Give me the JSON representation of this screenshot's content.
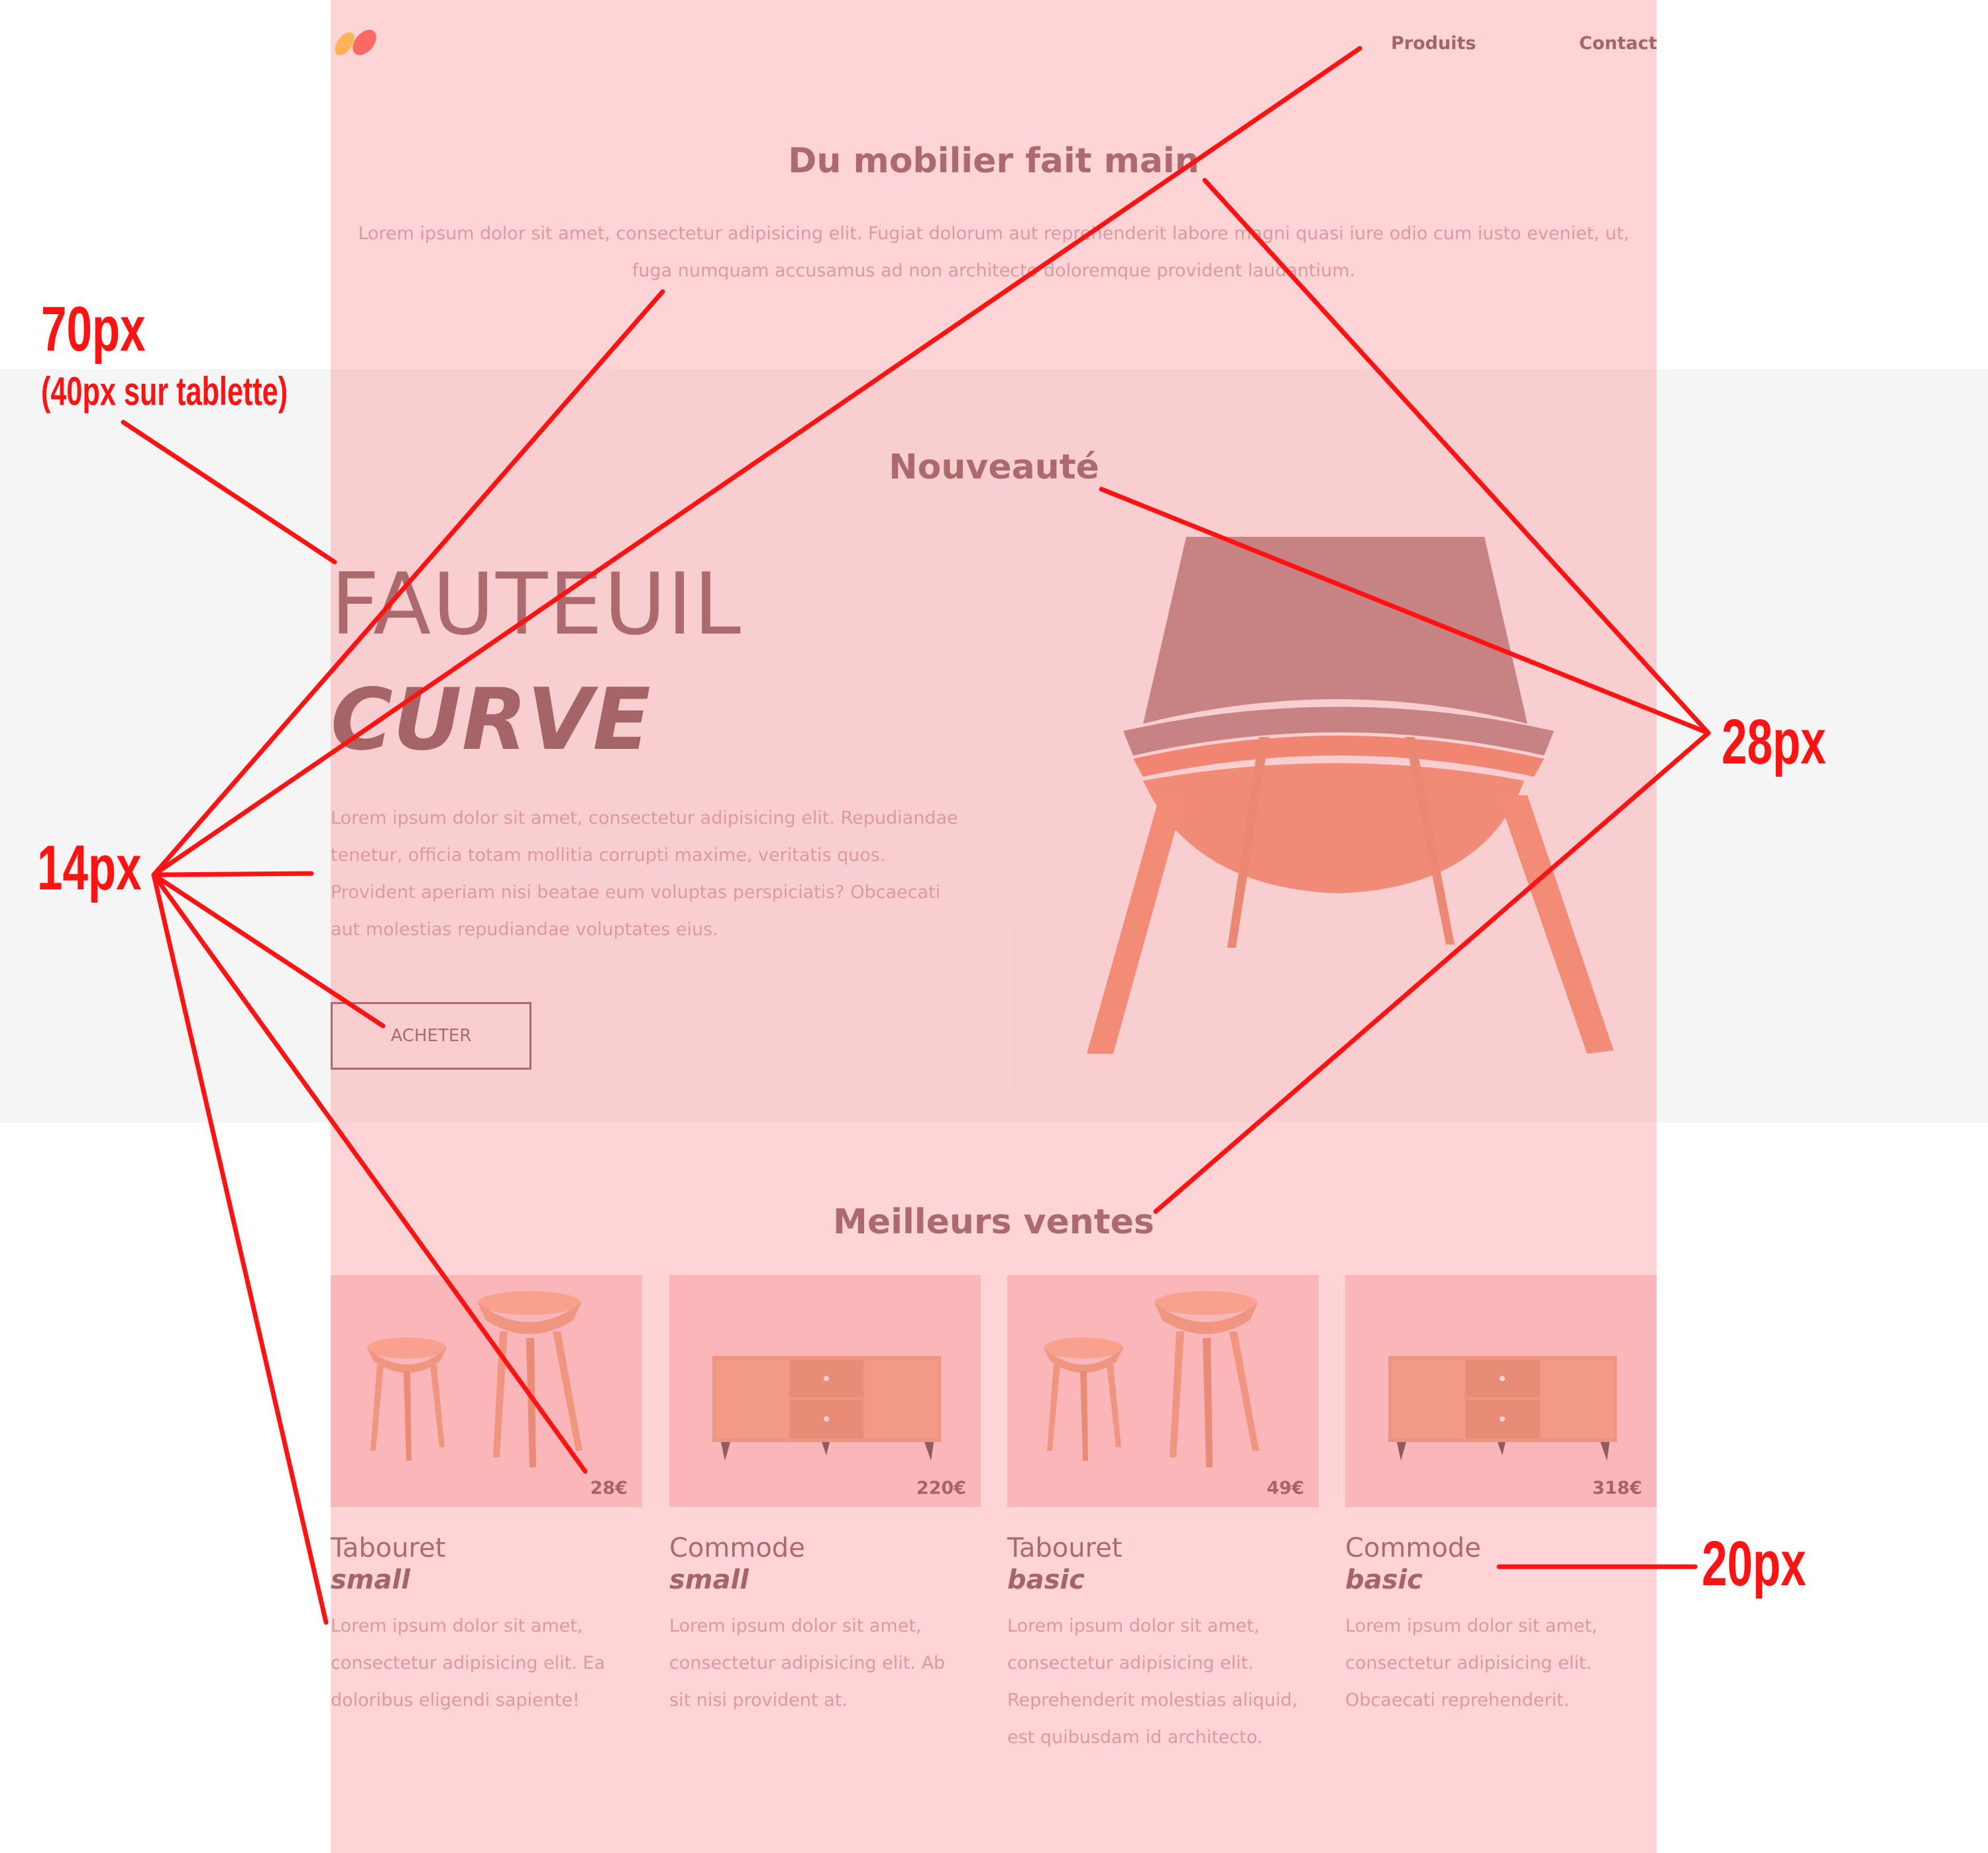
{
  "nav": {
    "products": "Produits",
    "contact": "Contact"
  },
  "intro": {
    "title": "Du mobilier fait main",
    "text_line1": "Lorem ipsum dolor sit amet, consectetur adipisicing elit. Fugiat dolorum aut reprehenderit labore magni quasi iure odio cum iusto eveniet, ut,",
    "text_line2": "fuga numquam accusamus ad non architecto doloremque provident laudantium."
  },
  "hero": {
    "label": "Nouveauté",
    "title": "FAUTEUIL",
    "subtitle": "CURVE",
    "text_lines": [
      "Lorem ipsum dolor sit amet, consectetur adipisicing elit. Repudiandae",
      "tenetur, officia totam mollitia corrupti maxime, veritatis quos.",
      "Provident aperiam nisi beatae eum voluptas perspiciatis? Obcaecati",
      "aut molestias repudiandae voluptates eius."
    ],
    "button": "ACHETER"
  },
  "best": {
    "title": "Meilleurs ventes",
    "products": [
      {
        "price": "28€",
        "name": "Tabouret",
        "variant": "small",
        "image": "stools-image",
        "desc_lines": [
          "Lorem ipsum dolor sit amet,",
          "consectetur adipisicing elit. Ea",
          "doloribus eligendi sapiente!"
        ]
      },
      {
        "price": "220€",
        "name": "Commode",
        "variant": "small",
        "image": "sideboard-image",
        "desc_lines": [
          "Lorem ipsum dolor sit amet,",
          "consectetur adipisicing elit. Ab",
          "sit nisi provident at."
        ]
      },
      {
        "price": "49€",
        "name": "Tabouret",
        "variant": "basic",
        "image": "stools-image",
        "desc_lines": [
          "Lorem ipsum dolor sit amet,",
          "consectetur adipisicing elit.",
          "Reprehenderit molestias aliquid,",
          "est quibusdam id architecto."
        ]
      },
      {
        "price": "318€",
        "name": "Commode",
        "variant": "basic",
        "image": "sideboard-image",
        "desc_lines": [
          "Lorem ipsum dolor sit amet,",
          "consectetur adipisicing elit.",
          "Obcaecati reprehenderit."
        ]
      }
    ]
  },
  "annotations": {
    "size_70": "70px",
    "size_70_note": "(40px sur tablette)",
    "size_14": "14px",
    "size_28": "28px",
    "size_20": "20px"
  },
  "colors": {
    "overlay": "#ffa0a5",
    "annotation": "#ff1212",
    "text_dark": "#6a3f42",
    "lorem": "#c49499",
    "band": "#f5f5f5"
  }
}
